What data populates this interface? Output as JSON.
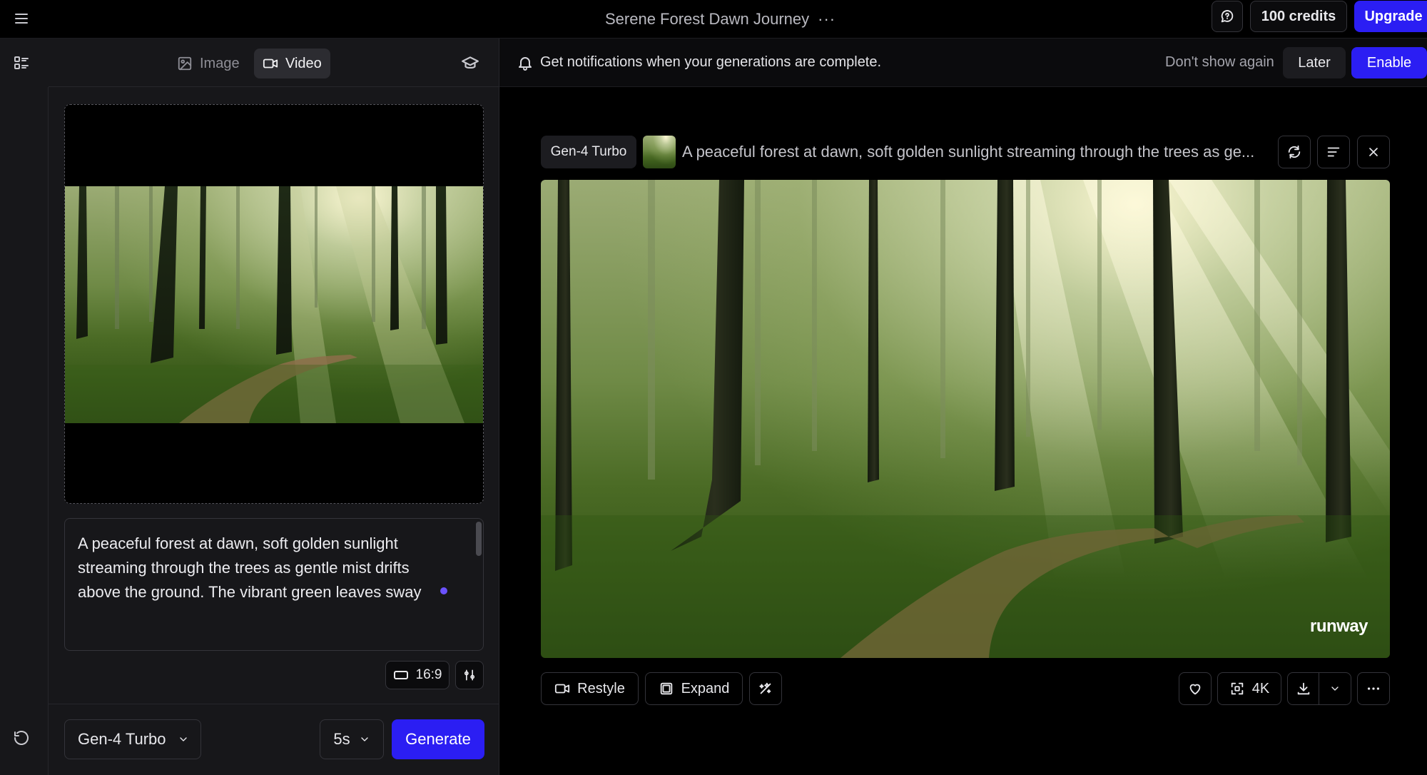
{
  "app": {
    "project_title": "Serene Forest Dawn Journey",
    "credits_label": "100 credits",
    "upgrade_label": "Upgrade"
  },
  "tabs": {
    "image": "Image",
    "video": "Video",
    "active": "video"
  },
  "notification": {
    "message": "Get notifications when your generations are complete.",
    "dont_show_label": "Don't show again",
    "later_label": "Later",
    "enable_label": "Enable"
  },
  "prompt": {
    "text": "A peaceful forest at dawn, soft golden sunlight streaming through the trees as gentle mist drifts above the ground. The vibrant green leaves sway"
  },
  "settings": {
    "aspect_ratio": "16:9",
    "model": "Gen-4 Turbo",
    "duration": "5s",
    "generate_label": "Generate"
  },
  "output": {
    "model_badge": "Gen-4 Turbo",
    "prompt_preview": "A peaceful forest at dawn, soft golden sunlight streaming through the trees as ge...",
    "watermark": "runway",
    "actions": {
      "restyle": "Restyle",
      "expand": "Expand",
      "upscale": "4K"
    }
  },
  "colors": {
    "accent": "#2b1ef3",
    "panel": "#17171a",
    "background": "#000000"
  }
}
